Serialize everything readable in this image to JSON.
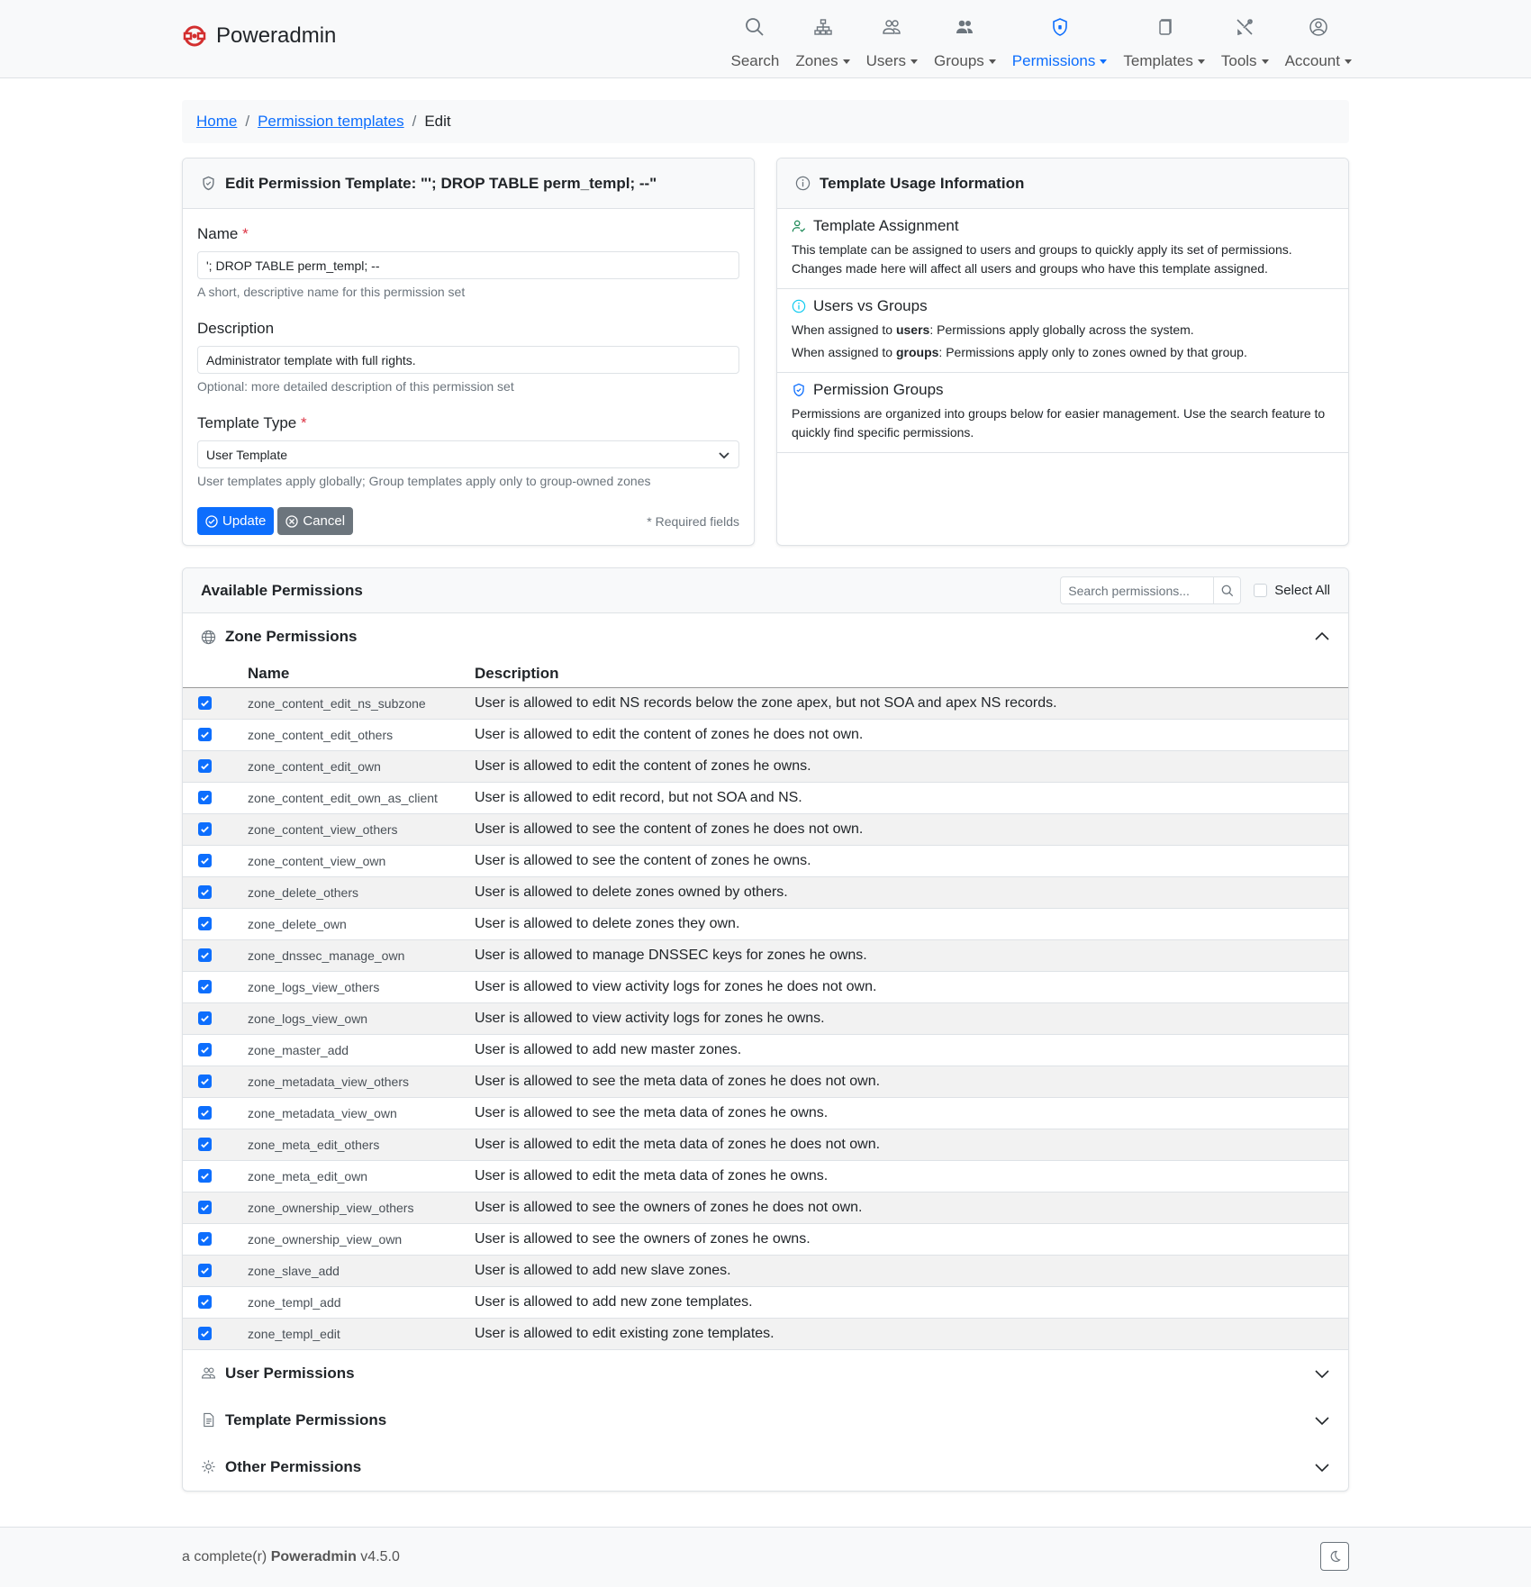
{
  "brand": {
    "name": "Poweradmin"
  },
  "nav": [
    {
      "label": "Search",
      "icon": "search-icon",
      "caret": false,
      "active": false
    },
    {
      "label": "Zones",
      "icon": "sitemap-icon",
      "caret": true,
      "active": false
    },
    {
      "label": "Users",
      "icon": "users-icon",
      "caret": true,
      "active": false
    },
    {
      "label": "Groups",
      "icon": "groups-icon",
      "caret": true,
      "active": false
    },
    {
      "label": "Permissions",
      "icon": "shield-icon",
      "caret": true,
      "active": true
    },
    {
      "label": "Templates",
      "icon": "files-icon",
      "caret": true,
      "active": false
    },
    {
      "label": "Tools",
      "icon": "tools-icon",
      "caret": true,
      "active": false
    },
    {
      "label": "Account",
      "icon": "person-circle-icon",
      "caret": true,
      "active": false
    }
  ],
  "breadcrumb": {
    "home": "Home",
    "templates": "Permission templates",
    "current": "Edit",
    "sep": "/"
  },
  "edit_card": {
    "title": "Edit Permission Template: \"'; DROP TABLE perm_templ; --\"",
    "name_label": "Name",
    "name_value": "'; DROP TABLE perm_templ; --",
    "name_help": "A short, descriptive name for this permission set",
    "desc_label": "Description",
    "desc_value": "Administrator template with full rights.",
    "desc_help": "Optional: more detailed description of this permission set",
    "type_label": "Template Type",
    "type_value": "User Template",
    "type_help": "User templates apply globally; Group templates apply only to group-owned zones",
    "required_mark": "*",
    "update_label": "Update",
    "cancel_label": "Cancel",
    "required_note": "* Required fields"
  },
  "info_card": {
    "title": "Template Usage Information",
    "assignment_title": "Template Assignment",
    "assignment_text": "This template can be assigned to users and groups to quickly apply its set of permissions. Changes made here will affect all users and groups who have this template assigned.",
    "uvg_title": "Users vs Groups",
    "uvg_users_pre": "When assigned to ",
    "uvg_users_bold": "users",
    "uvg_users_post": ": Permissions apply globally across the system.",
    "uvg_groups_pre": "When assigned to ",
    "uvg_groups_bold": "groups",
    "uvg_groups_post": ": Permissions apply only to zones owned by that group.",
    "pg_title": "Permission Groups",
    "pg_text": "Permissions are organized into groups below for easier management. Use the search feature to quickly find specific permissions."
  },
  "permissions": {
    "title": "Available Permissions",
    "search_placeholder": "Search permissions...",
    "select_all": "Select All",
    "zone_title": "Zone Permissions",
    "col_name": "Name",
    "col_desc": "Description",
    "rows": [
      {
        "name": "zone_content_edit_ns_subzone",
        "desc": "User is allowed to edit NS records below the zone apex, but not SOA and apex NS records."
      },
      {
        "name": "zone_content_edit_others",
        "desc": "User is allowed to edit the content of zones he does not own."
      },
      {
        "name": "zone_content_edit_own",
        "desc": "User is allowed to edit the content of zones he owns."
      },
      {
        "name": "zone_content_edit_own_as_client",
        "desc": "User is allowed to edit record, but not SOA and NS."
      },
      {
        "name": "zone_content_view_others",
        "desc": "User is allowed to see the content of zones he does not own."
      },
      {
        "name": "zone_content_view_own",
        "desc": "User is allowed to see the content of zones he owns."
      },
      {
        "name": "zone_delete_others",
        "desc": "User is allowed to delete zones owned by others."
      },
      {
        "name": "zone_delete_own",
        "desc": "User is allowed to delete zones they own."
      },
      {
        "name": "zone_dnssec_manage_own",
        "desc": "User is allowed to manage DNSSEC keys for zones he owns."
      },
      {
        "name": "zone_logs_view_others",
        "desc": "User is allowed to view activity logs for zones he does not own."
      },
      {
        "name": "zone_logs_view_own",
        "desc": "User is allowed to view activity logs for zones he owns."
      },
      {
        "name": "zone_master_add",
        "desc": "User is allowed to add new master zones."
      },
      {
        "name": "zone_metadata_view_others",
        "desc": "User is allowed to see the meta data of zones he does not own."
      },
      {
        "name": "zone_metadata_view_own",
        "desc": "User is allowed to see the meta data of zones he owns."
      },
      {
        "name": "zone_meta_edit_others",
        "desc": "User is allowed to edit the meta data of zones he does not own."
      },
      {
        "name": "zone_meta_edit_own",
        "desc": "User is allowed to edit the meta data of zones he owns."
      },
      {
        "name": "zone_ownership_view_others",
        "desc": "User is allowed to see the owners of zones he does not own."
      },
      {
        "name": "zone_ownership_view_own",
        "desc": "User is allowed to see the owners of zones he owns."
      },
      {
        "name": "zone_slave_add",
        "desc": "User is allowed to add new slave zones."
      },
      {
        "name": "zone_templ_add",
        "desc": "User is allowed to add new zone templates."
      },
      {
        "name": "zone_templ_edit",
        "desc": "User is allowed to edit existing zone templates."
      }
    ],
    "user_title": "User Permissions",
    "template_title": "Template Permissions",
    "other_title": "Other Permissions"
  },
  "footer": {
    "prefix": "a complete(r) ",
    "brand": "Poweradmin",
    "version": " v4.5.0"
  },
  "colors": {
    "primary": "#0d6efd",
    "secondary": "#6c757d",
    "danger": "#dc3545",
    "logo": "#d32f2f",
    "success": "#198754",
    "info": "#0dcaf0"
  }
}
